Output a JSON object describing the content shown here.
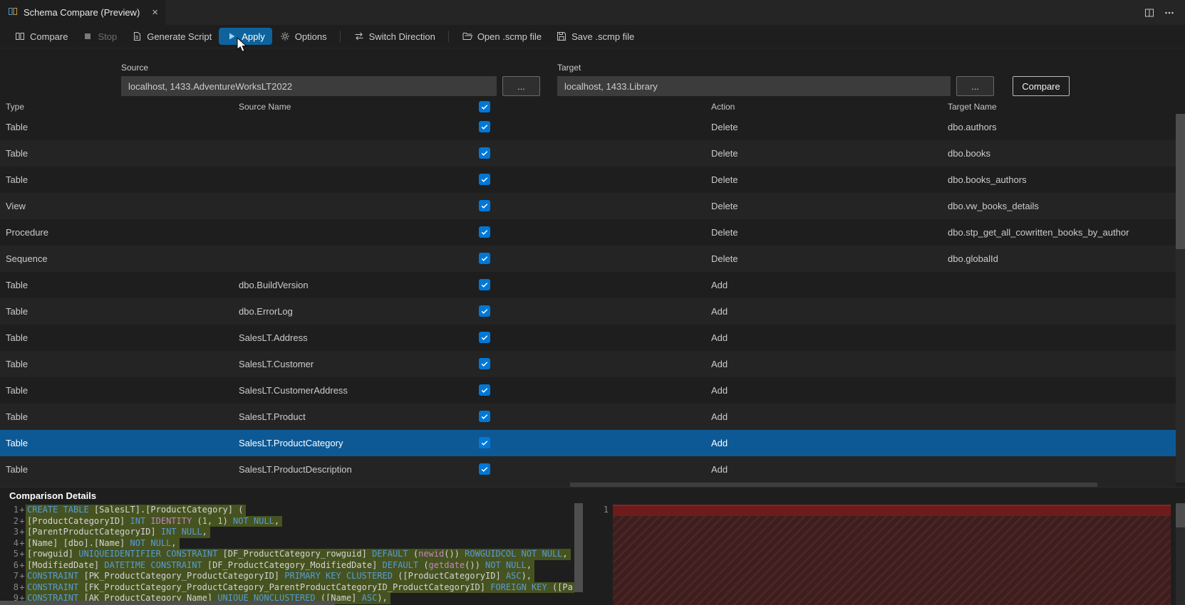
{
  "tab": {
    "title": "Schema Compare (Preview)",
    "close": "×"
  },
  "toolbar": {
    "items": [
      {
        "id": "compare",
        "label": "Compare",
        "icon": "compare-icon",
        "state": "normal"
      },
      {
        "id": "stop",
        "label": "Stop",
        "icon": "stop-icon",
        "state": "disabled"
      },
      {
        "id": "generate-script",
        "label": "Generate Script",
        "icon": "script-icon",
        "state": "normal"
      },
      {
        "id": "apply",
        "label": "Apply",
        "icon": "play-icon",
        "state": "active"
      },
      {
        "id": "options",
        "label": "Options",
        "icon": "gear-icon",
        "state": "normal"
      },
      {
        "id": "switch-direction",
        "label": "Switch Direction",
        "icon": "switch-icon",
        "state": "normal",
        "sep_before": true
      },
      {
        "id": "open-scmp",
        "label": "Open .scmp file",
        "icon": "folder-icon",
        "state": "normal",
        "sep_before": true
      },
      {
        "id": "save-scmp",
        "label": "Save .scmp file",
        "icon": "save-icon",
        "state": "normal"
      }
    ]
  },
  "connections": {
    "source_label": "Source",
    "source_value": "localhost, 1433.AdventureWorksLT2022",
    "target_label": "Target",
    "target_value": "localhost, 1433.Library",
    "browse_label": "...",
    "compare_label": "Compare"
  },
  "grid": {
    "headers": {
      "type": "Type",
      "source": "Source Name",
      "action": "Action",
      "target": "Target Name"
    },
    "header_checkbox_checked": true,
    "rows": [
      {
        "type": "Table",
        "source": "",
        "checked": true,
        "action": "Delete",
        "target": "dbo.authors"
      },
      {
        "type": "Table",
        "source": "",
        "checked": true,
        "action": "Delete",
        "target": "dbo.books"
      },
      {
        "type": "Table",
        "source": "",
        "checked": true,
        "action": "Delete",
        "target": "dbo.books_authors"
      },
      {
        "type": "View",
        "source": "",
        "checked": true,
        "action": "Delete",
        "target": "dbo.vw_books_details"
      },
      {
        "type": "Procedure",
        "source": "",
        "checked": true,
        "action": "Delete",
        "target": "dbo.stp_get_all_cowritten_books_by_author"
      },
      {
        "type": "Sequence",
        "source": "",
        "checked": true,
        "action": "Delete",
        "target": "dbo.globalId"
      },
      {
        "type": "Table",
        "source": "dbo.BuildVersion",
        "checked": true,
        "action": "Add",
        "target": ""
      },
      {
        "type": "Table",
        "source": "dbo.ErrorLog",
        "checked": true,
        "action": "Add",
        "target": ""
      },
      {
        "type": "Table",
        "source": "SalesLT.Address",
        "checked": true,
        "action": "Add",
        "target": ""
      },
      {
        "type": "Table",
        "source": "SalesLT.Customer",
        "checked": true,
        "action": "Add",
        "target": ""
      },
      {
        "type": "Table",
        "source": "SalesLT.CustomerAddress",
        "checked": true,
        "action": "Add",
        "target": ""
      },
      {
        "type": "Table",
        "source": "SalesLT.Product",
        "checked": true,
        "action": "Add",
        "target": ""
      },
      {
        "type": "Table",
        "source": "SalesLT.ProductCategory",
        "checked": true,
        "action": "Add",
        "target": "",
        "selected": true
      },
      {
        "type": "Table",
        "source": "SalesLT.ProductDescription",
        "checked": true,
        "action": "Add",
        "target": ""
      }
    ]
  },
  "details": {
    "title": "Comparison Details",
    "left": {
      "lines": [
        {
          "n": "1",
          "d": "+",
          "segs": [
            [
              "kw",
              "CREATE TABLE "
            ],
            [
              "pl",
              "[SalesLT].[ProductCategory] ("
            ]
          ]
        },
        {
          "n": "2",
          "d": "+",
          "segs": [
            [
              "pl",
              "[ProductCategoryID] "
            ],
            [
              "kw",
              "INT "
            ],
            [
              "mag",
              "IDENTITY "
            ],
            [
              "pl",
              "("
            ],
            [
              "num",
              "1"
            ],
            [
              "pl",
              ", "
            ],
            [
              "num",
              "1"
            ],
            [
              "pl",
              ") "
            ],
            [
              "kw",
              "NOT NULL"
            ],
            [
              "pl",
              ","
            ]
          ]
        },
        {
          "n": "3",
          "d": "+",
          "segs": [
            [
              "pl",
              "[ParentProductCategoryID] "
            ],
            [
              "kw",
              "INT NULL"
            ],
            [
              "pl",
              ","
            ]
          ]
        },
        {
          "n": "4",
          "d": "+",
          "segs": [
            [
              "pl",
              "[Name] [dbo].[Name] "
            ],
            [
              "kw",
              "NOT NULL"
            ],
            [
              "pl",
              ","
            ]
          ]
        },
        {
          "n": "5",
          "d": "+",
          "segs": [
            [
              "pl",
              "[rowguid] "
            ],
            [
              "kw",
              "UNIQUEIDENTIFIER CONSTRAINT "
            ],
            [
              "pl",
              "[DF_ProductCategory_rowguid] "
            ],
            [
              "kw",
              "DEFAULT "
            ],
            [
              "pl",
              "("
            ],
            [
              "mag",
              "newid"
            ],
            [
              "pl",
              "()) "
            ],
            [
              "kw",
              "ROWGUIDCOL NOT NULL"
            ],
            [
              "pl",
              ","
            ]
          ]
        },
        {
          "n": "6",
          "d": "+",
          "segs": [
            [
              "pl",
              "[ModifiedDate] "
            ],
            [
              "kw",
              "DATETIME CONSTRAINT "
            ],
            [
              "pl",
              "[DF_ProductCategory_ModifiedDate] "
            ],
            [
              "kw",
              "DEFAULT "
            ],
            [
              "pl",
              "("
            ],
            [
              "mag",
              "getdate"
            ],
            [
              "pl",
              "()) "
            ],
            [
              "kw",
              "NOT NULL"
            ],
            [
              "pl",
              ","
            ]
          ]
        },
        {
          "n": "7",
          "d": "+",
          "segs": [
            [
              "kw",
              "CONSTRAINT "
            ],
            [
              "pl",
              "[PK_ProductCategory_ProductCategoryID] "
            ],
            [
              "kw",
              "PRIMARY KEY CLUSTERED "
            ],
            [
              "pl",
              "([ProductCategoryID] "
            ],
            [
              "kw",
              "ASC"
            ],
            [
              "pl",
              "),"
            ]
          ]
        },
        {
          "n": "8",
          "d": "+",
          "segs": [
            [
              "kw",
              "CONSTRAINT "
            ],
            [
              "pl",
              "[FK_ProductCategory_ProductCategory_ParentProductCategoryID_ProductCategoryID] "
            ],
            [
              "kw",
              "FOREIGN KEY "
            ],
            [
              "pl",
              "([ParentProductCatego"
            ]
          ]
        },
        {
          "n": "9",
          "d": "+",
          "segs": [
            [
              "kw",
              "CONSTRAINT "
            ],
            [
              "pl",
              "[AK_ProductCategory_Name] "
            ],
            [
              "kw",
              "UNIQUE NONCLUSTERED "
            ],
            [
              "pl",
              "([Name] "
            ],
            [
              "kw",
              "ASC"
            ],
            [
              "pl",
              "),"
            ]
          ]
        }
      ]
    },
    "right": {
      "line_number": "1"
    }
  },
  "colors": {
    "accent": "#0e639c",
    "row_selection": "#0d5996",
    "checkbox": "#0078d7",
    "diff_add_bg": "#465320",
    "diff_del_bg": "#3d1e1e",
    "diff_del_stripe": "#4c2525",
    "diff_del_top": "#6e1b1b"
  }
}
